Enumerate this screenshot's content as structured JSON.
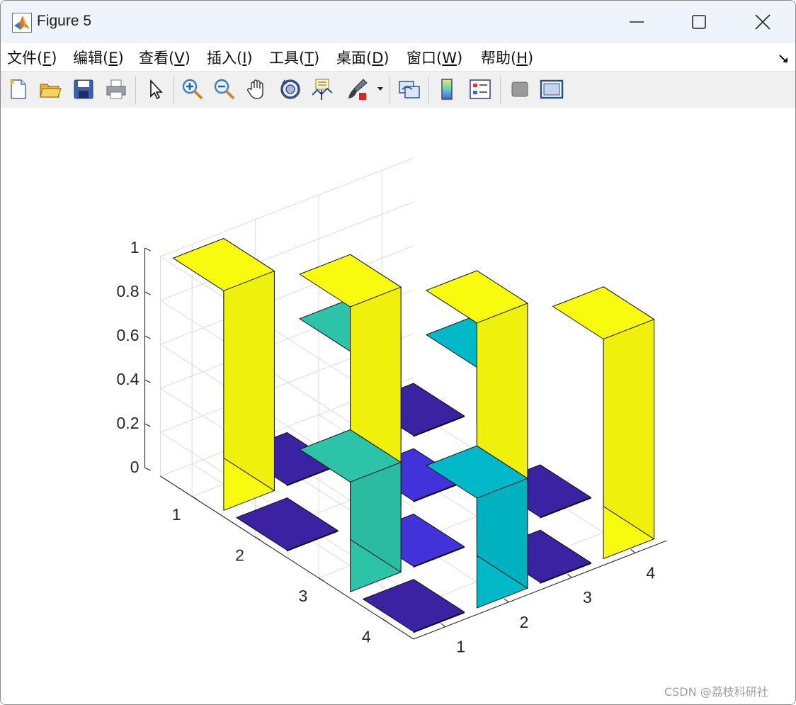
{
  "window": {
    "title": "Figure 5"
  },
  "menu": [
    {
      "pre": "文件(",
      "key": "F",
      "post": ")"
    },
    {
      "pre": "编辑(",
      "key": "E",
      "post": ")"
    },
    {
      "pre": "查看(",
      "key": "V",
      "post": ")"
    },
    {
      "pre": "插入(",
      "key": "I",
      "post": ")"
    },
    {
      "pre": "工具(",
      "key": "T",
      "post": ")"
    },
    {
      "pre": "桌面(",
      "key": "D",
      "post": ")"
    },
    {
      "pre": "窗口(",
      "key": "W",
      "post": ")"
    },
    {
      "pre": "帮助(",
      "key": "H",
      "post": ")"
    }
  ],
  "toolbar_icons": [
    "new-figure-icon",
    "open-file-icon",
    "save-icon",
    "print-icon",
    "select-pointer-icon",
    "zoom-in-icon",
    "zoom-out-icon",
    "pan-hand-icon",
    "rotate-3d-icon",
    "data-cursor-icon",
    "brush-icon",
    "dropdown-arrow-icon",
    "link-plot-icon",
    "colorbar-icon",
    "legend-icon",
    "hide-plot-tools-icon",
    "show-plot-tools-icon"
  ],
  "colors": {
    "yellow": "#f9fb0e",
    "teal": "#2dc3a9",
    "cyan": "#00b8c7",
    "blue": "#4232d9",
    "indigo": "#3a22a2"
  },
  "chart_data": {
    "type": "bar3",
    "rows": [
      "1",
      "2",
      "3",
      "4"
    ],
    "columns": [
      "1",
      "2",
      "3",
      "4"
    ],
    "values": [
      [
        1.0,
        0.0,
        0.5,
        0.0
      ],
      [
        0.0,
        1.0,
        0.0,
        0.5
      ],
      [
        0.5,
        0.0,
        1.0,
        0.0
      ],
      [
        0.0,
        0.5,
        0.0,
        1.0
      ]
    ],
    "bar_colors": [
      [
        "#f9fb0e",
        "#3a22a2",
        "#2dc3a9",
        "#3a22a2"
      ],
      [
        "#3a22a2",
        "#f9fb0e",
        "#4232d9",
        "#00b8c7"
      ],
      [
        "#2dc3a9",
        "#4232d9",
        "#f9fb0e",
        "#3a22a2"
      ],
      [
        "#3a22a2",
        "#00b8c7",
        "#3a22a2",
        "#f9fb0e"
      ]
    ],
    "zlim": [
      0,
      1
    ],
    "z_ticks": [
      "0",
      "0.2",
      "0.4",
      "0.6",
      "0.8",
      "1"
    ],
    "row_ticks": [
      "1",
      "2",
      "3",
      "4"
    ],
    "column_ticks": [
      "1",
      "2",
      "3",
      "4"
    ],
    "grid": true
  },
  "watermark": "CSDN @荔枝科研社"
}
